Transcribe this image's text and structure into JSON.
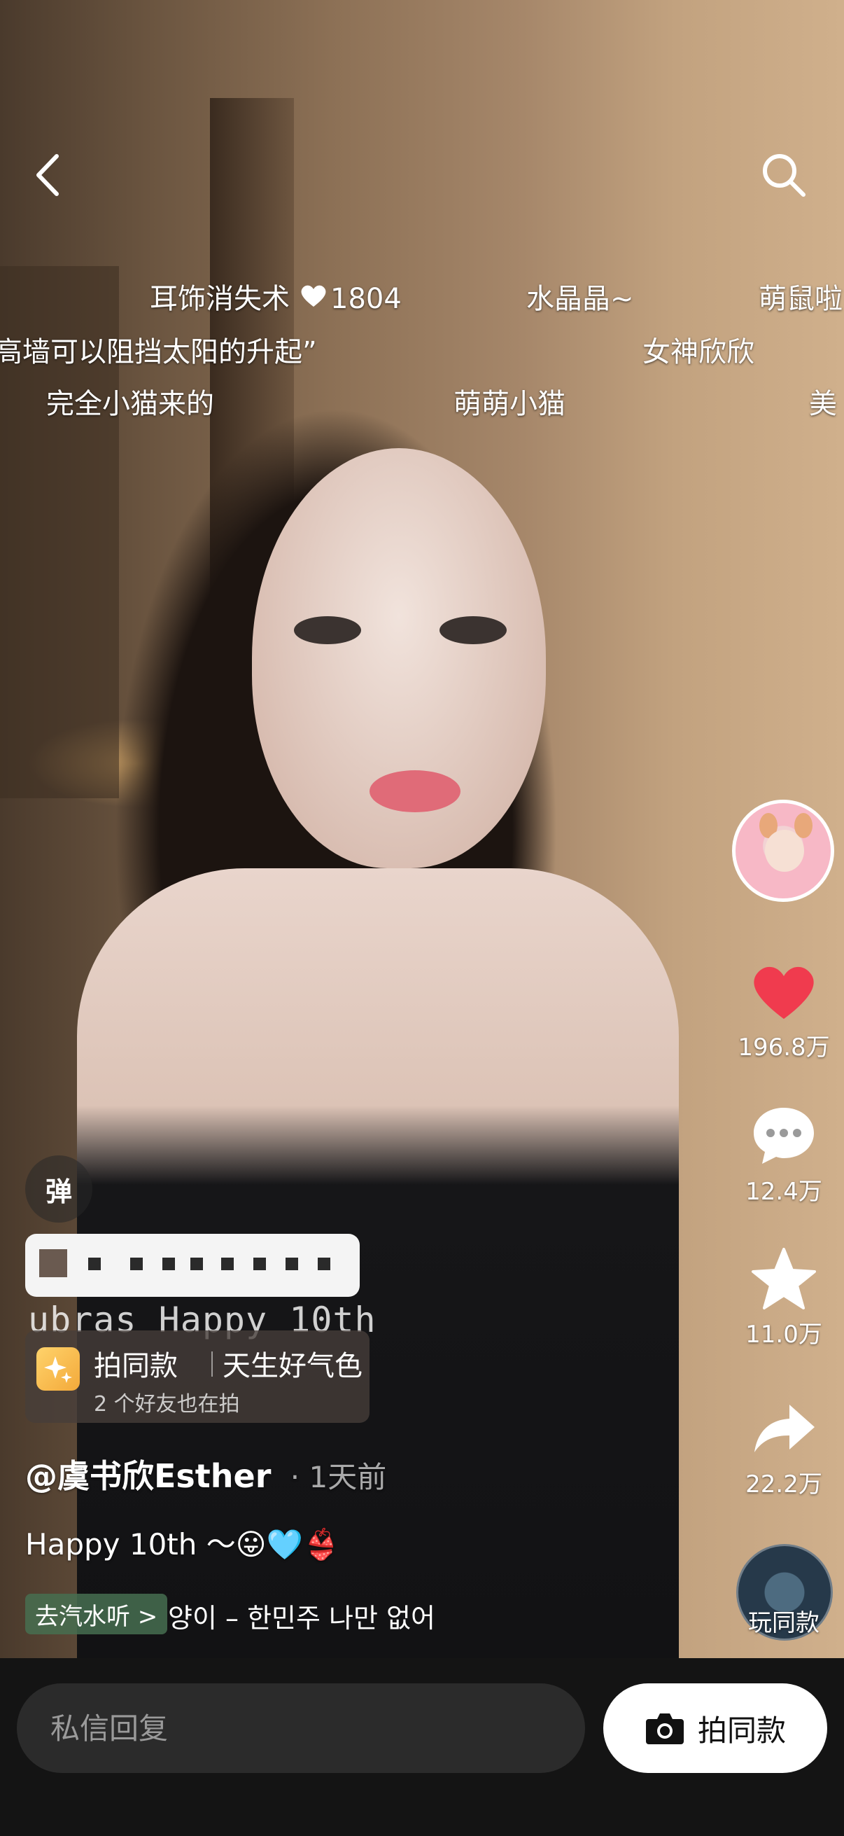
{
  "danmaku": [
    {
      "text": "耳饰消失术",
      "likes": "1804"
    },
    {
      "text": "水晶晶~"
    },
    {
      "text": "萌鼠啦"
    },
    {
      "text": "高墙可以阻挡太阳的升起”"
    },
    {
      "text": "女神欣欣"
    },
    {
      "text": "完全小猫来的"
    },
    {
      "text": "萌萌小猫"
    },
    {
      "text": "美"
    }
  ],
  "rail": {
    "likes": "196.8万",
    "comments": "12.4万",
    "favorites": "11.0万",
    "shares": "22.2万",
    "music_label": "玩同款"
  },
  "danmu_toggle": "弹",
  "overlay_text": "ubras Happy 10th",
  "effect": {
    "action": "拍同款",
    "name": "天生好气色",
    "friends": "2 个好友也在拍"
  },
  "author": "@虞书欣Esther",
  "post_time": "1天前",
  "caption": "Happy 10th ～😛🩵👙",
  "music_tag": "去汽水听 >",
  "music_title": "양이 – 한민주   나만 없어",
  "bottom": {
    "reply_placeholder": "私信回复",
    "shoot_label": "拍同款"
  },
  "colors": {
    "like_red": "#F03B4E",
    "bottom_bg": "#141414",
    "input_bg": "#2B2B2B"
  }
}
